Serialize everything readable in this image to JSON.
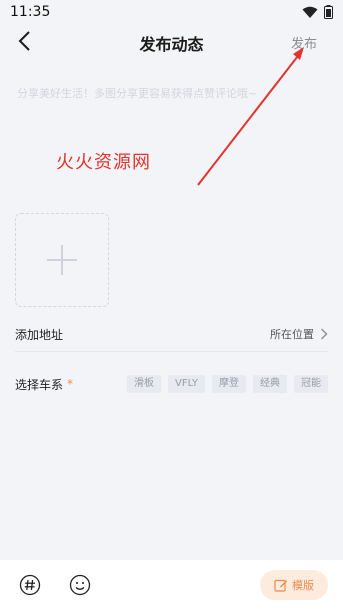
{
  "status_bar": {
    "time": "11:35"
  },
  "nav": {
    "title": "发布动态",
    "publish_label": "发布"
  },
  "editor": {
    "placeholder": "分享美好生活！多图分享更容易获得点赞评论哦~"
  },
  "watermark": "火火资源网",
  "address": {
    "label": "添加地址",
    "value": "所在位置"
  },
  "series": {
    "label": "选择车系",
    "required_mark": "*",
    "tags": [
      "滑板",
      "VFLY",
      "摩登",
      "经典",
      "冠能"
    ]
  },
  "bottom_bar": {
    "template_label": "模版"
  },
  "colors": {
    "accent": "#ef8a4b",
    "watermark": "#e2342e",
    "background": "#f3f4f8"
  }
}
